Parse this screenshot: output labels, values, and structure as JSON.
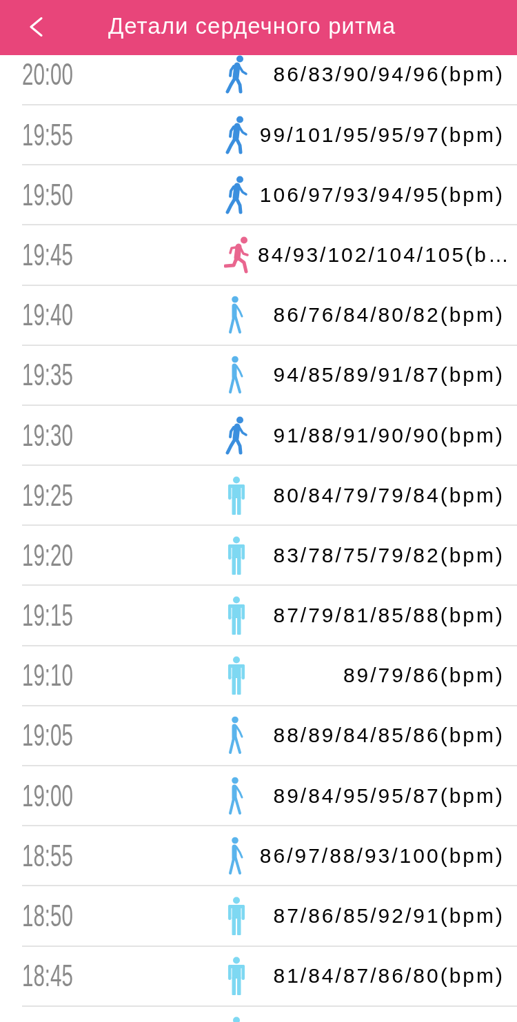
{
  "header": {
    "title": "Детали сердечного ритма"
  },
  "rows": [
    {
      "time": "20:00",
      "kind": "brisk_walk",
      "reading": "86/83/90/94/96(bpm)"
    },
    {
      "time": "19:55",
      "kind": "brisk_walk",
      "reading": "99/101/95/95/97(bpm)"
    },
    {
      "time": "19:50",
      "kind": "brisk_walk",
      "reading": "106/97/93/94/95(bpm)"
    },
    {
      "time": "19:45",
      "kind": "run",
      "reading": "84/93/102/104/105(b…"
    },
    {
      "time": "19:40",
      "kind": "walk",
      "reading": "86/76/84/80/82(bpm)"
    },
    {
      "time": "19:35",
      "kind": "walk",
      "reading": "94/85/89/91/87(bpm)"
    },
    {
      "time": "19:30",
      "kind": "brisk_walk",
      "reading": "91/88/91/90/90(bpm)"
    },
    {
      "time": "19:25",
      "kind": "stand",
      "reading": "80/84/79/79/84(bpm)"
    },
    {
      "time": "19:20",
      "kind": "stand",
      "reading": "83/78/75/79/82(bpm)"
    },
    {
      "time": "19:15",
      "kind": "stand",
      "reading": "87/79/81/85/88(bpm)"
    },
    {
      "time": "19:10",
      "kind": "stand",
      "reading": "89/79/86(bpm)"
    },
    {
      "time": "19:05",
      "kind": "walk",
      "reading": "88/89/84/85/86(bpm)"
    },
    {
      "time": "19:00",
      "kind": "walk",
      "reading": "89/84/95/95/87(bpm)"
    },
    {
      "time": "18:55",
      "kind": "walk",
      "reading": "86/97/88/93/100(bpm)"
    },
    {
      "time": "18:50",
      "kind": "stand",
      "reading": "87/86/85/92/91(bpm)"
    },
    {
      "time": "18:45",
      "kind": "stand",
      "reading": "81/84/87/86/80(bpm)"
    },
    {
      "kind": "stand"
    }
  ]
}
